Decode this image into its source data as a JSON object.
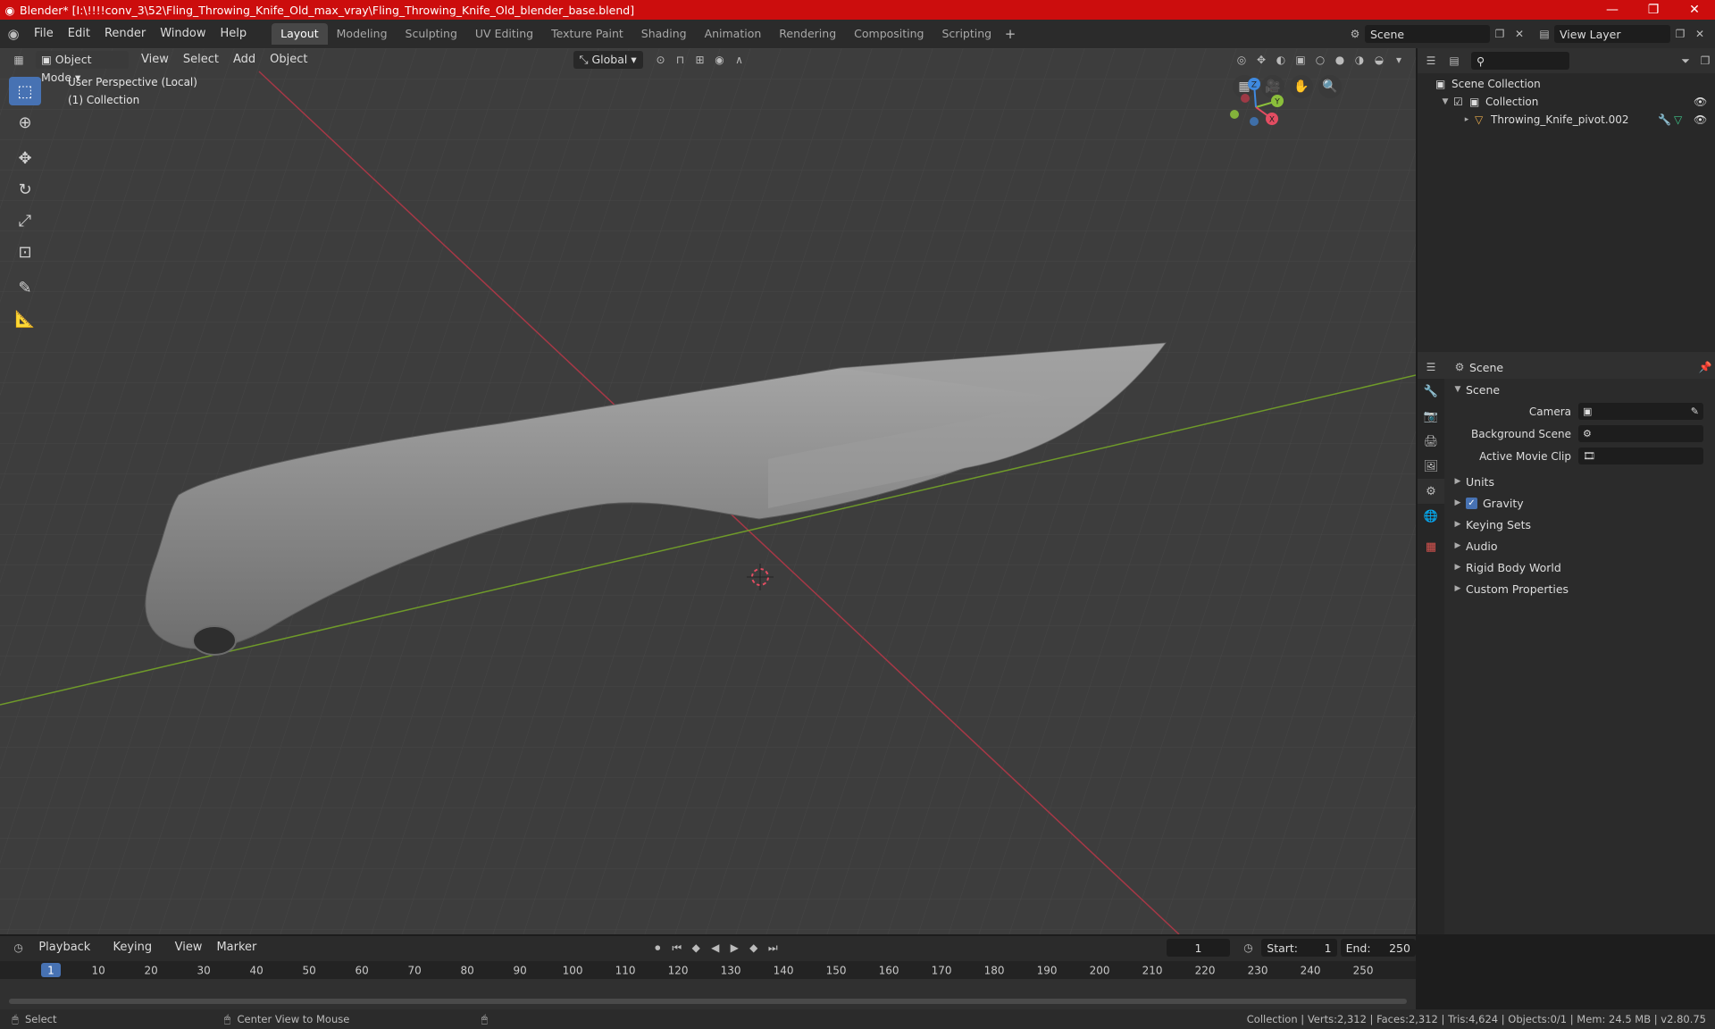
{
  "window": {
    "title": "Blender* [I:\\!!!!conv_3\\52\\Fling_Throwing_Knife_Old_max_vray\\Fling_Throwing_Knife_Old_blender_base.blend]",
    "minimize": "—",
    "maximize": "❐",
    "close": "✕"
  },
  "menu": [
    "File",
    "Edit",
    "Render",
    "Window",
    "Help"
  ],
  "workspaces": [
    "Layout",
    "Modeling",
    "Sculpting",
    "UV Editing",
    "Texture Paint",
    "Shading",
    "Animation",
    "Rendering",
    "Compositing",
    "Scripting"
  ],
  "active_workspace": "Layout",
  "scene_field": "Scene",
  "viewlayer_field": "View Layer",
  "viewport": {
    "mode": "Object Mode",
    "menus": [
      "View",
      "Select",
      "Add",
      "Object"
    ],
    "orientation": "Global",
    "info_line1": "User Perspective (Local)",
    "info_line2": "(1) Collection",
    "axis_colors": {
      "x": "#e34d62",
      "y": "#8bbf3b",
      "z": "#3f8ae0"
    },
    "gizmo_labels": {
      "x": "X",
      "y": "Y",
      "z": "Z"
    }
  },
  "outliner": {
    "root": "Scene Collection",
    "collection": "Collection",
    "object": "Throwing_Knife_pivot.002"
  },
  "properties": {
    "header": "Scene",
    "panel": "Scene",
    "fields": [
      {
        "label": "Camera",
        "value": ""
      },
      {
        "label": "Background Scene",
        "value": ""
      },
      {
        "label": "Active Movie Clip",
        "value": ""
      }
    ],
    "sections": [
      "Units",
      "Gravity",
      "Keying Sets",
      "Audio",
      "Rigid Body World",
      "Custom Properties"
    ],
    "gravity_checked": true
  },
  "timeline": {
    "menus": [
      "Playback",
      "Keying",
      "View",
      "Marker"
    ],
    "current_frame": "1",
    "start_label": "Start:",
    "start": "1",
    "end_label": "End:",
    "end": "250",
    "ticks": [
      "1",
      "10",
      "20",
      "30",
      "40",
      "50",
      "60",
      "70",
      "80",
      "90",
      "100",
      "110",
      "120",
      "130",
      "140",
      "150",
      "160",
      "170",
      "180",
      "190",
      "200",
      "210",
      "220",
      "230",
      "240",
      "250"
    ]
  },
  "status": {
    "left": "Select",
    "middle": "Center View to Mouse",
    "right": "Collection | Verts:2,312 | Faces:2,312 | Tris:4,624 | Objects:0/1 | Mem: 24.5 MB | v2.80.75"
  }
}
